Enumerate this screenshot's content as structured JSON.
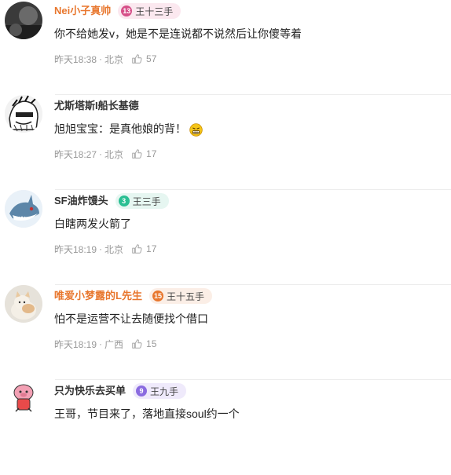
{
  "comments": [
    {
      "username": "Nei小子真帅",
      "name_color": "#e8772e",
      "badge": {
        "level": "13",
        "label": "王十三手",
        "bg": "#fbe8ef",
        "level_color": "#d64f88"
      },
      "text": "你不给她发v，她是不是连说都不说然后让你傻等着",
      "time": "昨天18:38",
      "location": "北京",
      "likes": "57",
      "avatar_icon": "dark-photo-avatar"
    },
    {
      "username": "尤斯塔斯I船长基德",
      "name_color": "#333333",
      "badge": null,
      "text": "旭旭宝宝：是真他娘的背！",
      "emoji_icon": "grimace-emoji-icon",
      "time": "昨天18:27",
      "location": "北京",
      "likes": "17",
      "avatar_icon": "manga-sketch-avatar"
    },
    {
      "username": "SF油炸馒头",
      "name_color": "#333333",
      "badge": {
        "level": "3",
        "label": "王三手",
        "bg": "#e6f6f1",
        "level_color": "#2bbf93"
      },
      "text": "白瞎两发火箭了",
      "time": "昨天18:19",
      "location": "北京",
      "likes": "17",
      "avatar_icon": "shark-cartoon-avatar"
    },
    {
      "username": "唯爱小梦露的L先生",
      "name_color": "#e8772e",
      "badge": {
        "level": "15",
        "label": "王十五手",
        "bg": "#fbeee6",
        "level_color": "#e8772e"
      },
      "text": "怕不是运营不让去随便找个借口",
      "time": "昨天18:19",
      "location": "广西",
      "likes": "15",
      "avatar_icon": "cat-photo-avatar"
    },
    {
      "username": "只为快乐去买单",
      "name_color": "#333333",
      "badge": {
        "level": "9",
        "label": "王九手",
        "bg": "#efeafb",
        "level_color": "#8a6be0"
      },
      "text": "王哥，节目来了，落地直接soul约一个",
      "time": "",
      "location": "",
      "likes": "",
      "avatar_icon": "pink-cartoon-avatar"
    }
  ],
  "like_icon": "thumbs-up-icon"
}
